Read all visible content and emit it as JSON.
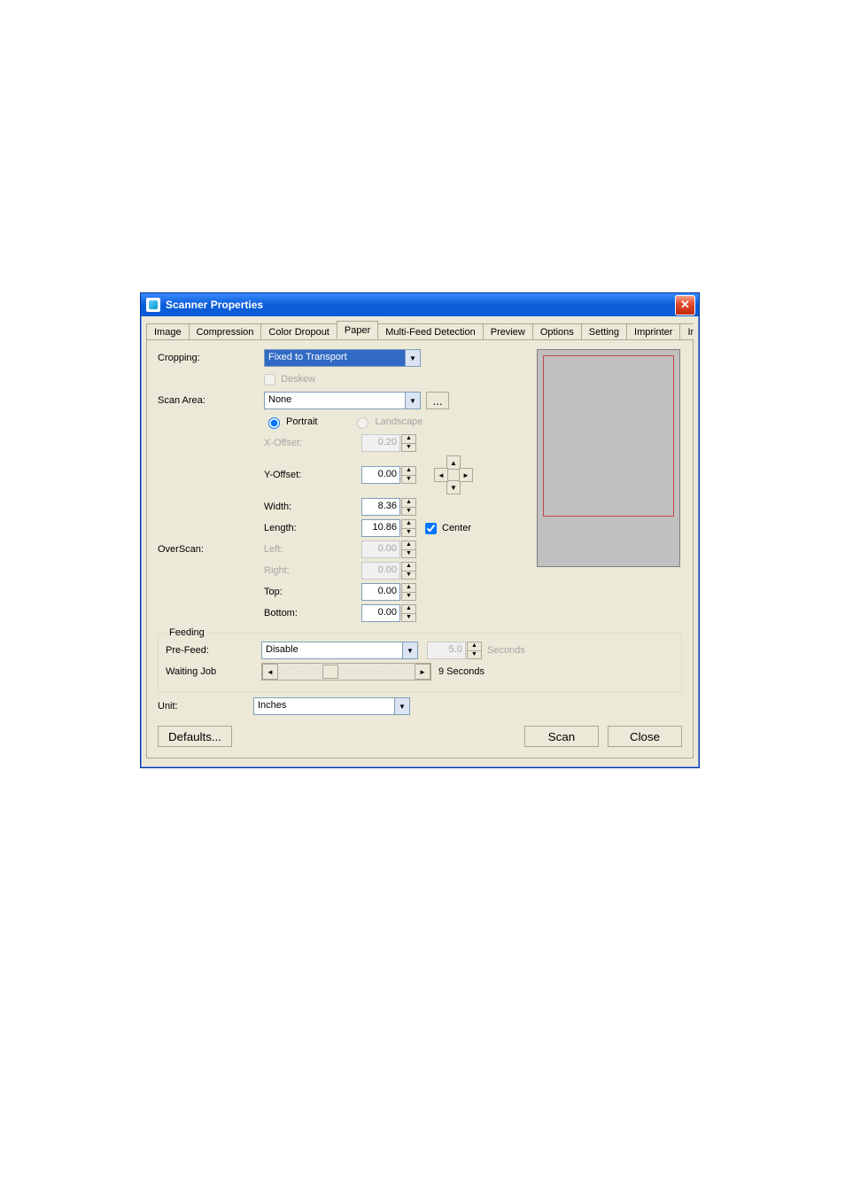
{
  "window": {
    "title": "Scanner Properties"
  },
  "tabs": {
    "items": [
      "Image",
      "Compression",
      "Color Dropout",
      "Paper",
      "Multi-Feed Detection",
      "Preview",
      "Options",
      "Setting",
      "Imprinter",
      "In"
    ],
    "active_index": 3
  },
  "cropping": {
    "label": "Cropping:",
    "value": "Fixed to Transport",
    "deskew_label": "Deskew",
    "deskew_checked": false
  },
  "scan_area": {
    "label": "Scan Area:",
    "value": "None",
    "browse": "...",
    "portrait_label": "Portrait",
    "landscape_label": "Landscape",
    "orientation": "portrait",
    "x_offset_label": "X-Offset:",
    "x_offset": "0.20",
    "y_offset_label": "Y-Offset:",
    "y_offset": "0.00",
    "width_label": "Width:",
    "width": "8.36",
    "length_label": "Length:",
    "length": "10.86",
    "center_label": "Center",
    "center_checked": true
  },
  "overscan": {
    "label": "OverScan:",
    "left_label": "Left:",
    "left": "0.00",
    "right_label": "Right:",
    "right": "0.00",
    "top_label": "Top:",
    "top": "0.00",
    "bottom_label": "Bottom:",
    "bottom": "0.00"
  },
  "feeding": {
    "legend": "Feeding",
    "pre_feed_label": "Pre-Feed:",
    "pre_feed_value": "Disable",
    "pre_feed_seconds": "5.0",
    "seconds_label": "Seconds",
    "waiting_label": "Waiting Job",
    "waiting_value": "9 Seconds"
  },
  "unit": {
    "label": "Unit:",
    "value": "Inches"
  },
  "buttons": {
    "defaults": "Defaults...",
    "scan": "Scan",
    "close": "Close"
  }
}
